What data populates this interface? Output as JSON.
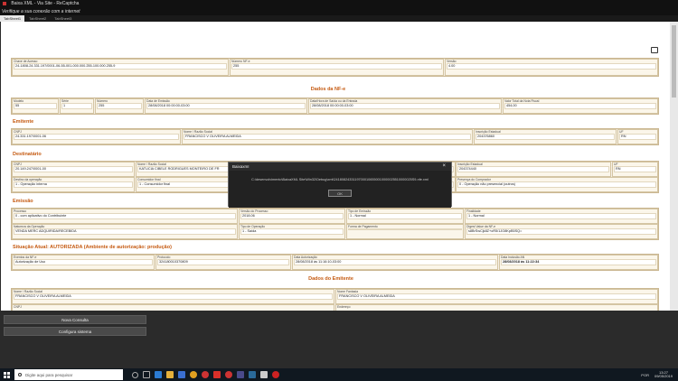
{
  "window": {
    "title": "Baixa XML - Via Site - ReCaptcha",
    "subtitle": "Verifique a sua conexão com a internet"
  },
  "tabs": [
    "TabSheet1",
    "TabSheet2",
    "TabSheet3"
  ],
  "header": {
    "chave_label": "Chave de Acesso",
    "chave_value": "24-1808-24.331.197/0001-06-55-001-000.000.255-100.000.255-9",
    "numero_label": "Número NF-e",
    "numero_value": "255",
    "versao_label": "Versão",
    "versao_value": "4.00"
  },
  "dados_nfe": {
    "title": "Dados da NF-e",
    "modelo_label": "Modelo",
    "modelo": "55",
    "serie_label": "Série",
    "serie": "1",
    "numero_label": "Número",
    "numero": "255",
    "emissao_label": "Data de Emissão",
    "emissao": "28/08/2018 00:00:00-03:00",
    "saida_label": "Data/Hora de Saída ou da Entrada",
    "saida": "28/08/2018 00:00:00-03:00",
    "total_label": "Valor Total da Nota Fiscal",
    "total": "454,00"
  },
  "emitente": {
    "title": "Emitente",
    "cnpj_label": "CNPJ",
    "cnpj": "24.331.197/0001-06",
    "nome_label": "Nome / Razão Social",
    "nome": "FRANCISCO V OLIVEIRA ALMEIDA",
    "ie_label": "Inscrição Estadual",
    "ie": "204376860",
    "uf_label": "UF",
    "uf": "RN"
  },
  "destinatario": {
    "title": "Destinatário",
    "cnpj_label": "CNPJ",
    "cnpj": "20.149.247/0001-00",
    "nome_label": "Nome / Razão Social",
    "nome": "KATUCIA CIBELE RODRIGUES MONTEIRO DE FR",
    "ie_label": "Inscrição Estadual",
    "ie": "204374440",
    "uf_label": "UF",
    "uf": "RN",
    "destino_label": "Destino da operação",
    "destino": "1 - Operação interna",
    "consumidor_label": "Consumidor final",
    "consumidor": "1 - Consumidor final",
    "presenca_label": "Presença do Comprador",
    "presenca": "0 - Operação não presencial (outros)"
  },
  "emissao": {
    "title": "Emissão",
    "processo_label": "Processo",
    "processo": "0 - com aplicativo do Contribuinte",
    "versao_label": "Versão do Processo",
    "versao": "2018.06",
    "tipo_label": "Tipo de Emissão",
    "tipo": "1 - Normal",
    "finalidade_label": "Finalidade",
    "finalidade": "1 - Normal",
    "natureza_label": "Natureza da Operação",
    "natureza": "VENDA MERC ADQUIRIDA/RECEBIDA",
    "tipo_op_label": "Tipo de Operação",
    "tipo_op": "1 - Saída",
    "forma_label": "Forma de Pagamento",
    "forma": "",
    "digest_label": "Digest Value da NF-e",
    "digest": "s8BrSwCjk8Z+oR5/1JO8KpB5SQ="
  },
  "situacao": {
    "title": "Situação Atual: AUTORIZADA (Ambiente de autorização: produção)",
    "eventos_label": "Eventos da NF-e",
    "eventos": "Autorização de Uso",
    "protocolo_label": "Protocolo",
    "protocolo": "324180010370809",
    "data_aut_label": "Data Autorização",
    "data_aut": "28/08/2018 às 11:16:10-03:00",
    "data_inc_label": "Data Inclusão AN",
    "data_inc": "28/08/2018 às 11:22:34"
  },
  "dados_emitente": {
    "title": "Dados do Emitente",
    "nome_label": "Nome / Razão Social",
    "nome": "FRANCISCO V OLIVEIRA ALMEIDA",
    "fantasia_label": "Nome Fantasia",
    "fantasia": "FRANCISCO V OLIVEIRA ALMEIDA",
    "cnpj_label": "CNPJ",
    "endereco_label": "Endereço"
  },
  "dialog": {
    "title": "BaixaxmI",
    "message": "C:\\desenvolvimento\\BaixaXML Site\\Win32\\Debug\\xml\\24180824331197000106550010000025510000025S9-nfe.xml",
    "ok": "OK"
  },
  "buttons": {
    "nova": "Nova Consulta",
    "config": "Configura sistema"
  },
  "taskbar": {
    "search_placeholder": "Digite aqui para pesquisar",
    "time": "13:27",
    "date": "09/05/2019",
    "lang": "POR"
  }
}
